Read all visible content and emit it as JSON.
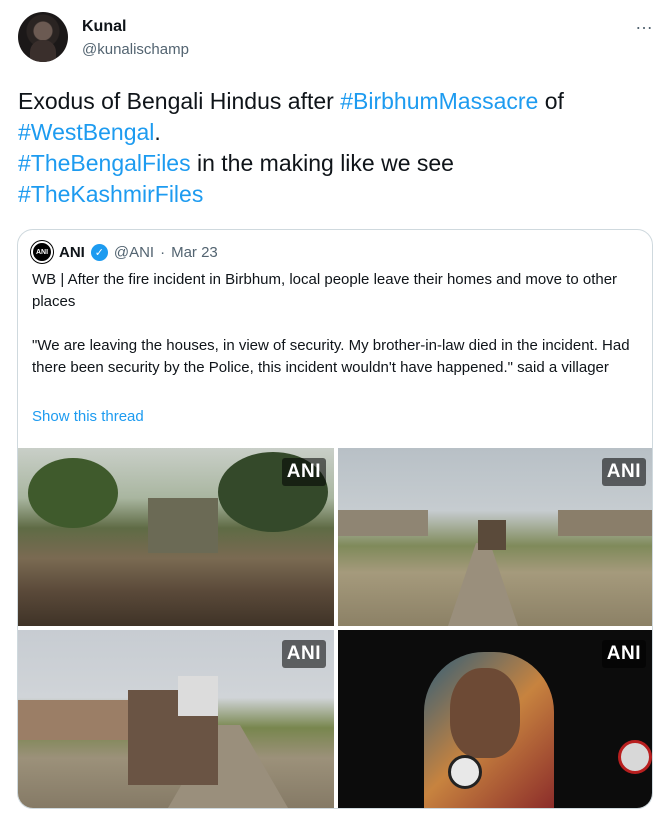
{
  "author": {
    "display_name": "Kunal",
    "handle": "@kunalischamp",
    "more_icon": "…"
  },
  "tweet": {
    "parts": [
      {
        "text": "Exodus of Bengali Hindus after ",
        "type": "text"
      },
      {
        "text": "#BirbhumMassacre",
        "type": "hashtag"
      },
      {
        "text": " of ",
        "type": "text"
      },
      {
        "text": "#WestBengal",
        "type": "hashtag"
      },
      {
        "text": ".",
        "type": "text"
      },
      {
        "text": "#TheBengalFiles",
        "type": "hashtag"
      },
      {
        "text": " in the making like we see",
        "type": "text"
      },
      {
        "text": "#TheKashmirFiles",
        "type": "hashtag"
      }
    ]
  },
  "quote": {
    "logo_text": "ANI",
    "name": "ANI",
    "verified_icon": "✓",
    "handle": "@ANI",
    "separator": "·",
    "date": "Mar 23",
    "paragraph1": "WB | After the fire incident in Birbhum, local people leave their homes and move to other places",
    "paragraph2": "\"We are leaving the houses, in view of security. My brother-in-law died in the incident. Had there been security by the Police, this incident wouldn't have happened.\" said a villager",
    "show_thread": "Show this thread",
    "photos": [
      {
        "watermark": "ANI"
      },
      {
        "watermark": "ANI"
      },
      {
        "watermark": "ANI"
      },
      {
        "watermark": "ANI"
      }
    ]
  },
  "colors": {
    "link": "#1d9bf0",
    "text": "#0f1419",
    "secondary": "#536471",
    "border": "#cfd9de"
  }
}
